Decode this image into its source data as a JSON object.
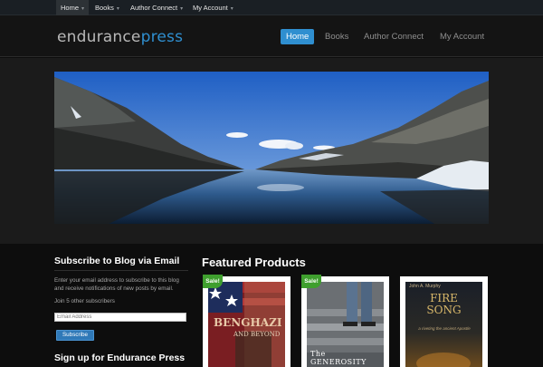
{
  "admin_bar": {
    "items": [
      {
        "label": "Home"
      },
      {
        "label": "Books"
      },
      {
        "label": "Author Connect"
      },
      {
        "label": "My Account"
      }
    ]
  },
  "header": {
    "logo_part1": "endurance",
    "logo_part2": "press",
    "nav": [
      {
        "label": "Home"
      },
      {
        "label": "Books"
      },
      {
        "label": "Author Connect"
      },
      {
        "label": "My Account"
      }
    ]
  },
  "sidebar": {
    "subscribe_title": "Subscribe to Blog via Email",
    "subscribe_text": "Enter your email address to subscribe to this blog and receive notifications of new posts by email.",
    "subscriber_count": "Join 5 other subscribers",
    "email_placeholder": "Email Address",
    "subscribe_button": "Subscribe",
    "signup_title": "Sign up for Endurance Press"
  },
  "featured": {
    "title": "Featured Products",
    "sale_label": "Sale!",
    "products": [
      {
        "cover_title": "BENGHAZI",
        "cover_subtitle": "AND BEYOND",
        "on_sale": true
      },
      {
        "cover_title": "The GENEROSITY",
        "on_sale": true
      },
      {
        "cover_title": "FIRE SONG",
        "cover_author": "John A. Murphy",
        "cover_tagline": "a riveting the ancient Apostle",
        "on_sale": false
      }
    ]
  },
  "colors": {
    "accent": "#2f8fd0",
    "sale": "#3f9f2e",
    "background": "#0d0d0d"
  }
}
